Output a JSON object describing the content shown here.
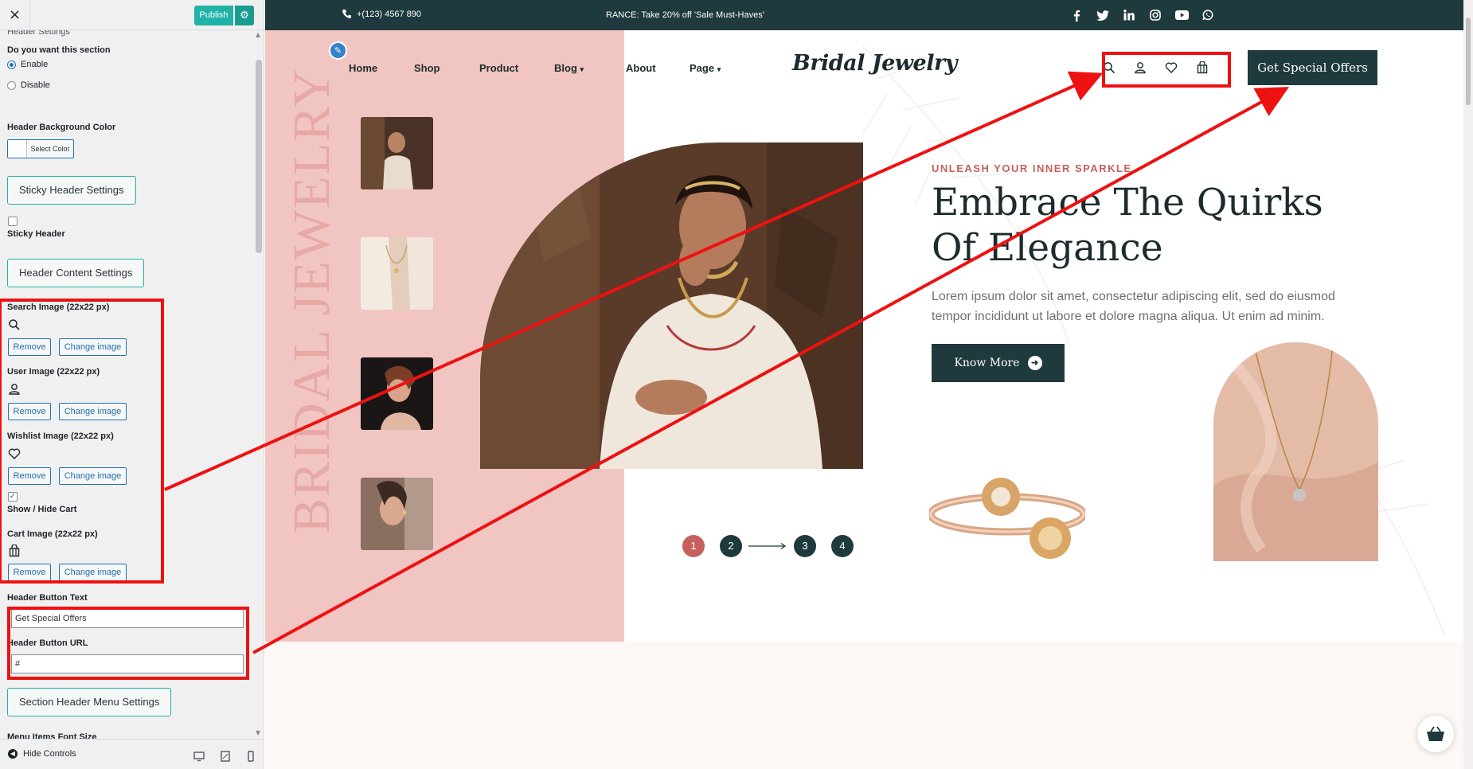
{
  "sidebar": {
    "close_icon": "×",
    "publish_label": "Publish",
    "publish_gear_icon": "⚙",
    "section_title": "Header Settings",
    "enable_question": "Do you want this section",
    "enable_label": "Enable",
    "disable_label": "Disable",
    "enabled": true,
    "bg_color_label": "Header Background Color",
    "select_color_label": "Select Color",
    "sticky_settings_btn": "Sticky Header Settings",
    "sticky_header_label": "Sticky Header",
    "sticky_checked": false,
    "content_settings_btn": "Header Content Settings",
    "search_image_label": "Search Image (22x22 px)",
    "user_image_label": "User Image (22x22 px)",
    "wishlist_image_label": "Wishlist Image (22x22 px)",
    "show_hide_cart_label": "Show / Hide Cart",
    "show_hide_cart_checked": true,
    "cart_image_label": "Cart Image (22x22 px)",
    "remove_label": "Remove",
    "change_image_label": "Change image",
    "header_button_text_label": "Header Button Text",
    "header_button_text_value": "Get Special Offers",
    "header_button_url_label": "Header Button URL",
    "header_button_url_value": "#",
    "menu_settings_btn": "Section Header Menu Settings",
    "menu_font_size_label": "Menu Items Font Size",
    "hide_controls_label": "Hide Controls"
  },
  "site": {
    "phone": "+(123) 4567 890",
    "marquee": "RANCE: Take 20% off 'Sale Must-Haves'",
    "social_icons": [
      "facebook-icon",
      "twitter-icon",
      "linkedin-icon",
      "instagram-icon",
      "youtube-icon",
      "whatsapp-icon"
    ],
    "nav": {
      "home": "Home",
      "shop": "Shop",
      "product": "Product",
      "blog": "Blog",
      "about": "About",
      "page": "Page"
    },
    "logo": "Bridal Jewelry",
    "header_button": "Get Special Offers",
    "vertical_title": "BRIDAL JEWELRY",
    "eyebrow": "UNLEASH YOUR INNER SPARKLE",
    "headline": "Embrace The Quirks Of Elegance",
    "lead": "Lorem ipsum dolor sit amet, consectetur adipiscing elit, sed do eiusmod tempor incididunt ut labore et dolore magna aliqua. Ut enim ad minim.",
    "cta": "Know More",
    "pager": [
      "1",
      "2",
      "3",
      "4"
    ],
    "active_slide": 1
  },
  "colors": {
    "accent": "#20b2a6",
    "brand_dark": "#1f3a3d",
    "pink": "#f1c5c1",
    "rose": "#c6605c",
    "annotation": "#ee1111"
  }
}
